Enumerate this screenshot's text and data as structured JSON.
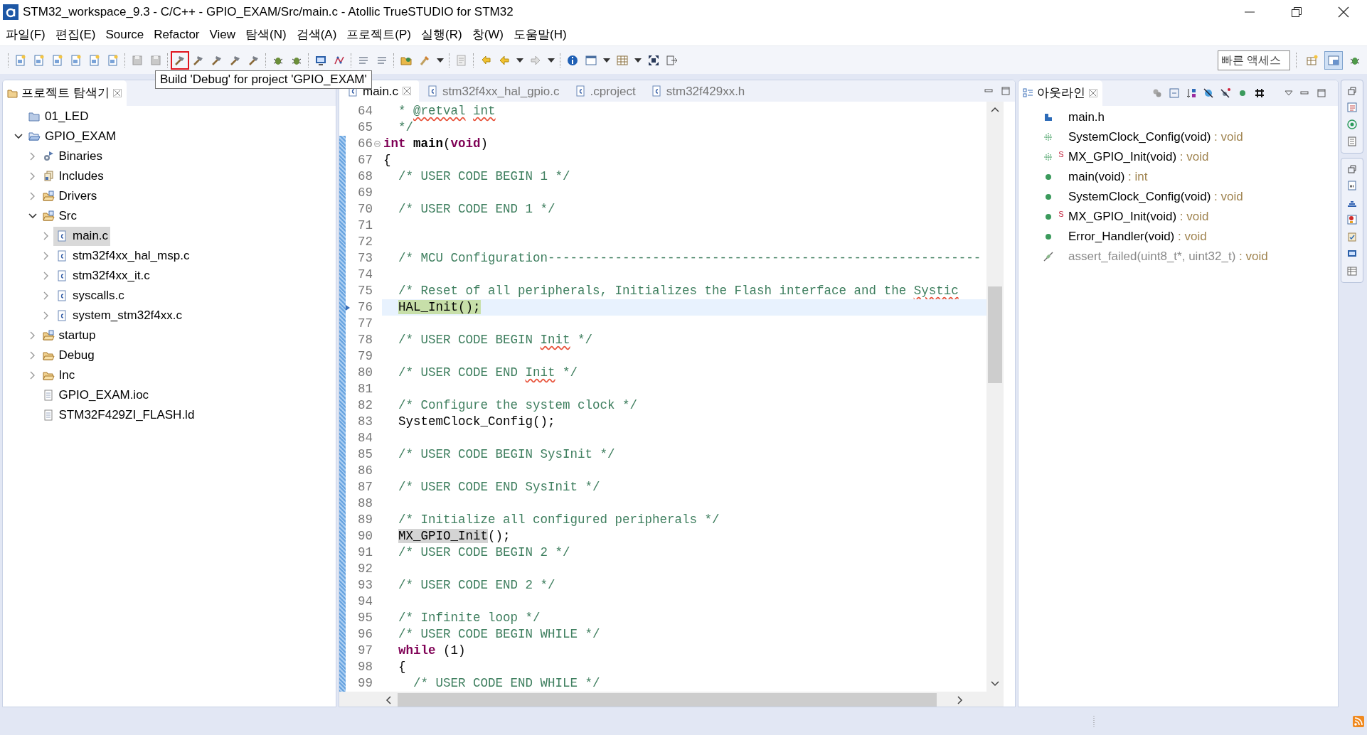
{
  "window": {
    "title": "STM32_workspace_9.3 - C/C++ - GPIO_EXAM/Src/main.c - Atollic TrueSTUDIO for STM32"
  },
  "menu": [
    "파일(F)",
    "편집(E)",
    "Source",
    "Refactor",
    "View",
    "탐색(N)",
    "검색(A)",
    "프로젝트(P)",
    "실행(R)",
    "창(W)",
    "도움말(H)"
  ],
  "toolbar": {
    "groups": [
      [
        {
          "outlined": false
        },
        {
          "outlined": false
        },
        {
          "outlined": false
        },
        {
          "outlined": false
        },
        {
          "outlined": false
        },
        {
          "outlined": false
        }
      ],
      [
        {
          "outlined": false
        },
        {
          "outlined": false
        }
      ],
      [
        {
          "outlined": true
        },
        {
          "outlined": false
        },
        {
          "outlined": false
        },
        {
          "outlined": false
        },
        {
          "outlined": false
        }
      ],
      [
        {
          "outlined": false
        },
        {
          "outlined": false
        }
      ],
      [
        {
          "outlined": false
        },
        {
          "outlined": false
        }
      ],
      [
        {
          "outlined": false
        },
        {
          "outlined": false
        }
      ],
      [
        {
          "outlined": false
        },
        {
          "outlined": false
        },
        {
          "outlined": false
        }
      ],
      [
        {
          "outlined": false
        }
      ],
      [
        {
          "outlined": false
        },
        {
          "outlined": false
        },
        {
          "outlined": false
        },
        {
          "outlined": false
        },
        {
          "outlined": false
        }
      ],
      [
        {
          "outlined": false
        },
        {
          "outlined": false
        },
        {
          "outlined": false
        },
        {
          "outlined": false
        },
        {
          "outlined": false
        },
        {
          "outlined": false
        },
        {
          "outlined": false
        }
      ]
    ],
    "quick_access": {
      "placeholder": "빠른 액세스"
    },
    "perspectives": [
      {
        "selected": false
      },
      {
        "selected": true
      },
      {
        "selected": false
      }
    ]
  },
  "tooltip": "Build 'Debug' for project 'GPIO_EXAM'",
  "project_explorer": {
    "title": "프로젝트 탐색기",
    "tree": [
      {
        "label": "01_LED",
        "kind": "project-closed",
        "selected": false
      },
      {
        "label": "GPIO_EXAM",
        "kind": "project",
        "expanded": true,
        "selected": false,
        "children": [
          {
            "label": "Binaries",
            "kind": "binaries",
            "expanded": false,
            "selected": false
          },
          {
            "label": "Includes",
            "kind": "includes",
            "expanded": false,
            "selected": false
          },
          {
            "label": "Drivers",
            "kind": "source-folder",
            "expanded": false,
            "selected": false
          },
          {
            "label": "Src",
            "kind": "source-folder",
            "expanded": true,
            "selected": false,
            "children": [
              {
                "label": "main.c",
                "kind": "c-file",
                "expanded": false,
                "selected": true
              },
              {
                "label": "stm32f4xx_hal_msp.c",
                "kind": "c-file",
                "expanded": false,
                "selected": false
              },
              {
                "label": "stm32f4xx_it.c",
                "kind": "c-file",
                "expanded": false,
                "selected": false
              },
              {
                "label": "syscalls.c",
                "kind": "c-file",
                "expanded": false,
                "selected": false
              },
              {
                "label": "system_stm32f4xx.c",
                "kind": "c-file",
                "expanded": false,
                "selected": false
              }
            ]
          },
          {
            "label": "startup",
            "kind": "source-folder",
            "expanded": false,
            "selected": false
          },
          {
            "label": "Debug",
            "kind": "folder",
            "expanded": false,
            "selected": false
          },
          {
            "label": "Inc",
            "kind": "folder",
            "expanded": false,
            "selected": false
          },
          {
            "label": "GPIO_EXAM.ioc",
            "kind": "file",
            "selected": false
          },
          {
            "label": "STM32F429ZI_FLASH.ld",
            "kind": "file",
            "selected": false
          }
        ]
      }
    ]
  },
  "editor": {
    "tabs": [
      {
        "label": "main.c",
        "selected": true
      },
      {
        "label": "stm32f4xx_hal_gpio.c",
        "selected": false
      },
      {
        "label": ".cproject",
        "selected": false
      },
      {
        "label": "stm32f429xx.h",
        "selected": false
      }
    ],
    "lines": [
      {
        "number": "64",
        "diff": false,
        "fold": false,
        "current": false,
        "segments": [
          {
            "kind": "comment",
            "text": "  * "
          },
          {
            "kind": "spell",
            "text": "@retval"
          },
          {
            "kind": "spell",
            "text": " int"
          }
        ]
      },
      {
        "number": "65",
        "diff": false,
        "fold": false,
        "current": false,
        "segments": [
          {
            "kind": "comment",
            "text": "  */"
          }
        ]
      },
      {
        "number": "66",
        "diff": true,
        "fold": true,
        "current": false,
        "segments": [
          {
            "kind": "keyword",
            "text": "int"
          },
          {
            "kind": "func",
            "text": " main"
          },
          {
            "kind": "code",
            "text": "("
          },
          {
            "kind": "keyword",
            "text": "void"
          },
          {
            "kind": "code",
            "text": ")"
          }
        ]
      },
      {
        "number": "67",
        "diff": true,
        "fold": false,
        "current": false,
        "segments": [
          {
            "kind": "code",
            "text": "{"
          }
        ]
      },
      {
        "number": "68",
        "diff": true,
        "fold": false,
        "current": false,
        "segments": [
          {
            "kind": "comment",
            "text": "  /* USER CODE BEGIN 1 */"
          }
        ]
      },
      {
        "number": "69",
        "diff": true,
        "fold": false,
        "current": false
      },
      {
        "number": "70",
        "diff": true,
        "fold": false,
        "current": false,
        "segments": [
          {
            "kind": "comment",
            "text": "  /* USER CODE END 1 */"
          }
        ]
      },
      {
        "number": "71",
        "diff": true,
        "fold": false,
        "current": false
      },
      {
        "number": "72",
        "diff": true,
        "fold": false,
        "current": false
      },
      {
        "number": "73",
        "diff": true,
        "fold": false,
        "current": false,
        "segments": [
          {
            "kind": "comment",
            "text": "  /* MCU Configuration----------------------------------------------------------"
          }
        ]
      },
      {
        "number": "74",
        "diff": true,
        "fold": false,
        "current": false
      },
      {
        "number": "75",
        "diff": true,
        "fold": false,
        "current": false,
        "segments": [
          {
            "kind": "comment",
            "text": "  /* Reset of all peripherals, Initializes the Flash interface and the "
          },
          {
            "kind": "spell",
            "text": "Systic"
          }
        ]
      },
      {
        "number": "76",
        "diff": true,
        "fold": false,
        "current": true,
        "segments": [
          {
            "kind": "debug",
            "text": "  HAL_Init();"
          }
        ]
      },
      {
        "number": "77",
        "diff": true,
        "fold": false,
        "current": false
      },
      {
        "number": "78",
        "diff": true,
        "fold": false,
        "current": false,
        "segments": [
          {
            "kind": "comment",
            "text": "  /* USER CODE BEGIN "
          },
          {
            "kind": "spell",
            "text": "Init"
          },
          {
            "kind": "comment",
            "text": " */"
          }
        ]
      },
      {
        "number": "79",
        "diff": true,
        "fold": false,
        "current": false
      },
      {
        "number": "80",
        "diff": true,
        "fold": false,
        "current": false,
        "segments": [
          {
            "kind": "comment",
            "text": "  /* USER CODE END "
          },
          {
            "kind": "spell",
            "text": "Init"
          },
          {
            "kind": "comment",
            "text": " */"
          }
        ]
      },
      {
        "number": "81",
        "diff": true,
        "fold": false,
        "current": false
      },
      {
        "number": "82",
        "diff": true,
        "fold": false,
        "current": false,
        "segments": [
          {
            "kind": "comment",
            "text": "  /* Configure the system clock */"
          }
        ]
      },
      {
        "number": "83",
        "diff": true,
        "fold": false,
        "current": false,
        "segments": [
          {
            "kind": "code",
            "text": "  SystemClock_Config();"
          }
        ]
      },
      {
        "number": "84",
        "diff": true,
        "fold": false,
        "current": false
      },
      {
        "number": "85",
        "diff": true,
        "fold": false,
        "current": false,
        "segments": [
          {
            "kind": "comment",
            "text": "  /* USER CODE BEGIN SysInit */"
          }
        ]
      },
      {
        "number": "86",
        "diff": true,
        "fold": false,
        "current": false
      },
      {
        "number": "87",
        "diff": true,
        "fold": false,
        "current": false,
        "segments": [
          {
            "kind": "comment",
            "text": "  /* USER CODE END SysInit */"
          }
        ]
      },
      {
        "number": "88",
        "diff": true,
        "fold": false,
        "current": false
      },
      {
        "number": "89",
        "diff": true,
        "fold": false,
        "current": false,
        "segments": [
          {
            "kind": "comment",
            "text": "  /* Initialize all configured peripherals */"
          }
        ]
      },
      {
        "number": "90",
        "diff": true,
        "fold": false,
        "current": false,
        "segments": [
          {
            "kind": "mark",
            "text": "  MX_GPIO_Init"
          },
          {
            "kind": "code",
            "text": "();"
          }
        ]
      },
      {
        "number": "91",
        "diff": true,
        "fold": false,
        "current": false,
        "segments": [
          {
            "kind": "comment",
            "text": "  /* USER CODE BEGIN 2 */"
          }
        ]
      },
      {
        "number": "92",
        "diff": true,
        "fold": false,
        "current": false
      },
      {
        "number": "93",
        "diff": true,
        "fold": false,
        "current": false,
        "segments": [
          {
            "kind": "comment",
            "text": "  /* USER CODE END 2 */"
          }
        ]
      },
      {
        "number": "94",
        "diff": true,
        "fold": false,
        "current": false
      },
      {
        "number": "95",
        "diff": true,
        "fold": false,
        "current": false,
        "segments": [
          {
            "kind": "comment",
            "text": "  /* Infinite loop */"
          }
        ]
      },
      {
        "number": "96",
        "diff": true,
        "fold": false,
        "current": false,
        "segments": [
          {
            "kind": "comment",
            "text": "  /* USER CODE BEGIN WHILE */"
          }
        ]
      },
      {
        "number": "97",
        "diff": true,
        "fold": false,
        "current": false,
        "segments": [
          {
            "kind": "keyword",
            "text": "  while"
          },
          {
            "kind": "code",
            "text": " (1)"
          }
        ]
      },
      {
        "number": "98",
        "diff": true,
        "fold": false,
        "current": false,
        "segments": [
          {
            "kind": "code",
            "text": "  {"
          }
        ]
      },
      {
        "number": "99",
        "diff": true,
        "fold": false,
        "current": false,
        "segments": [
          {
            "kind": "comment",
            "text": "    /* USER CODE END WHILE */"
          }
        ]
      }
    ]
  },
  "outline": {
    "title": "아웃라인",
    "items": [
      {
        "kind": "include",
        "name": "main.h"
      },
      {
        "kind": "declaration",
        "name": "SystemClock_Config(void)",
        "type": ": void"
      },
      {
        "kind": "declaration",
        "name": "MX_GPIO_Init(void)",
        "type": ": void",
        "badge": "S"
      },
      {
        "kind": "function",
        "name": "main(void)",
        "type": ": int"
      },
      {
        "kind": "function",
        "name": "SystemClock_Config(void)",
        "type": ": void"
      },
      {
        "kind": "function",
        "name": "MX_GPIO_Init(void)",
        "type": ": void",
        "badge": "S"
      },
      {
        "kind": "function",
        "name": "Error_Handler(void)",
        "type": ": void"
      },
      {
        "kind": "inactive",
        "name": "assert_failed(uint8_t*, uint32_t)",
        "type": ": void"
      }
    ]
  }
}
